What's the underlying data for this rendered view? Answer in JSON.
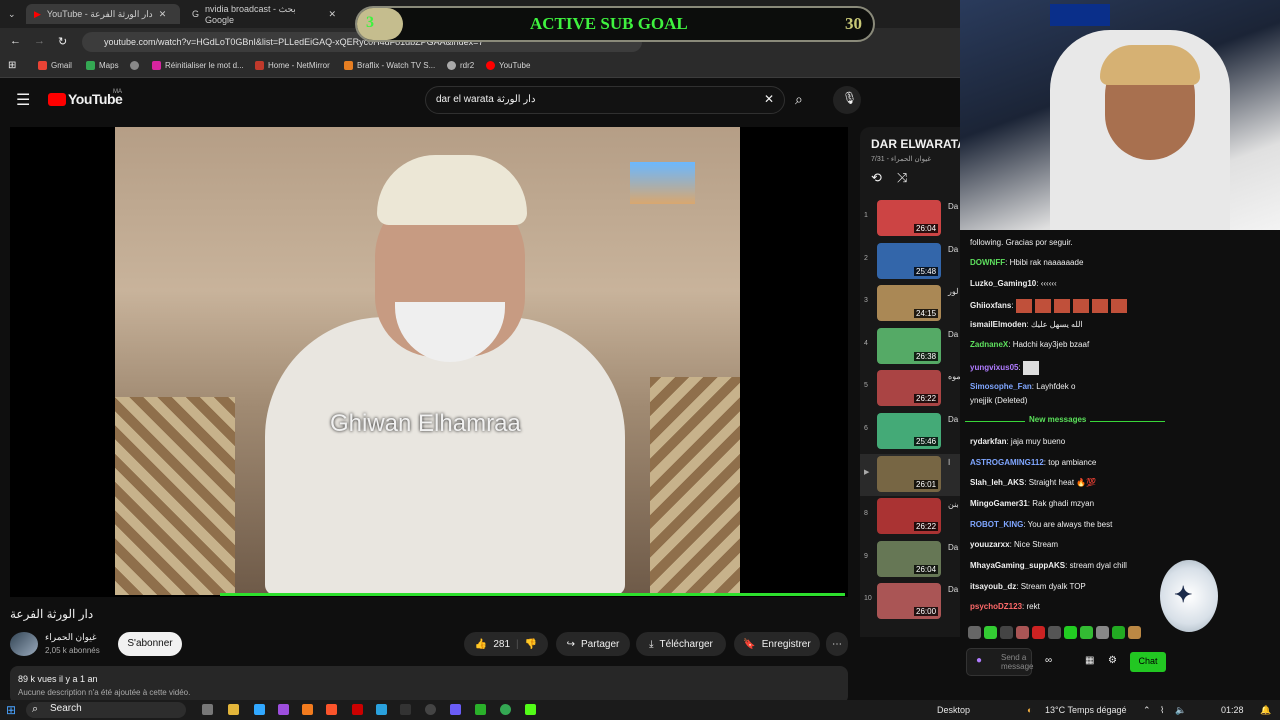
{
  "browser": {
    "tabs": [
      {
        "label": "YouTube - دار الورثة الفرعة"
      },
      {
        "label": "nvidia broadcast - بحث Google"
      }
    ],
    "url": "youtube.com/watch?v=HGdLoT0GBnI&list=PLLedEiGAQ-xQERyc0H4dFo1dbZPGAA&index=7",
    "bookmarks": [
      "Gmail",
      "Maps",
      "Réinitialiser le mot d...",
      "Home - NetMirror",
      "Braflix - Watch TV S...",
      "rdr2",
      "YouTube"
    ]
  },
  "youtube": {
    "logo": "YouTube",
    "logo_sup": "MA",
    "search_value": "dar el warata دار الورثة",
    "video_title": "دار الورثة الفرعة",
    "watermark": "Ghiwan Elhamraa",
    "channel_name": "غيوان الحمراء",
    "channel_subs": "2,05 k abonnés",
    "subscribe": "S'abonner",
    "likes": "281",
    "share": "Partager",
    "download": "Télécharger",
    "save": "Enregistrer",
    "views": "89 k vues  il y a 1 an",
    "description": "Aucune description n'a été ajoutée à cette vidéo."
  },
  "playlist": {
    "title": "DAR ELWARATA",
    "subtitle": "غيوان الحمراء - 7/31",
    "items": [
      {
        "num": "1",
        "dur": "26:04",
        "t": "Da"
      },
      {
        "num": "2",
        "dur": "25:48",
        "t": "Da"
      },
      {
        "num": "3",
        "dur": "24:15",
        "t": "لور"
      },
      {
        "num": "4",
        "dur": "26:38",
        "t": "Da"
      },
      {
        "num": "5",
        "dur": "26:22",
        "t": "موه"
      },
      {
        "num": "6",
        "dur": "25:46",
        "t": "Da"
      },
      {
        "num": "▶",
        "dur": "26:01",
        "t": "ا"
      },
      {
        "num": "8",
        "dur": "26:22",
        "t": "بنن"
      },
      {
        "num": "9",
        "dur": "26:04",
        "t": "Da"
      },
      {
        "num": "10",
        "dur": "26:00",
        "t": "Da"
      }
    ]
  },
  "overlay": {
    "goal_title": "ACTIVE SUB GOAL",
    "goal_current": "3",
    "goal_target": "30"
  },
  "chat": {
    "messages": [
      {
        "user": "",
        "text": "following. Gracias por seguir.",
        "color": "#efefef"
      },
      {
        "user": "DOWNFF",
        "text": "Hbibi rak naaaaaade",
        "color": "#5ee05e"
      },
      {
        "user": "Luzko_Gaming10",
        "text": "‹‹‹‹‹‹",
        "color": "#efefef"
      },
      {
        "user": "Ghiioxfans",
        "text": "",
        "color": "#efefef"
      },
      {
        "user": "ismailElmoden",
        "text": "الله يسهل عليك",
        "color": "#efefef"
      },
      {
        "user": "ZadnaneX",
        "text": "Hadchi kay3jeb bzaaf",
        "color": "#5ee05e"
      },
      {
        "user": "yungvixus05",
        "text": "",
        "color": "#b07cff"
      },
      {
        "user": "Simosophe_Fan",
        "text": "Layhfdek o",
        "color": "#7fa6ff"
      },
      {
        "user": "",
        "text": "ynejjik (Deleted)",
        "color": "#efefef"
      },
      {
        "user": "rydarkfan",
        "text": "jaja muy bueno",
        "color": "#efefef"
      },
      {
        "user": "ASTROGAMING112",
        "text": "top ambiance",
        "color": "#7fa6ff"
      },
      {
        "user": "Slah_leh_AKS",
        "text": "Straight heat 🔥💯",
        "color": "#efefef"
      },
      {
        "user": "MingoGamer31",
        "text": "Rak ghadi mzyan",
        "color": "#efefef"
      },
      {
        "user": "ROBOT_KING",
        "text": "You are always the best",
        "color": "#7fa6ff"
      },
      {
        "user": "youuzarxx",
        "text": "Nice Stream",
        "color": "#efefef"
      },
      {
        "user": "MhayaGaming_suppAKS",
        "text": "stream dyal chill",
        "color": "#efefef"
      },
      {
        "user": "itsayoub_dz",
        "text": "Stream dyalk TOP",
        "color": "#efefef"
      },
      {
        "user": "psychoDZ123",
        "text": "rekt",
        "color": "#ff6a6a"
      }
    ],
    "new_messages": "New messages",
    "input_placeholder": "Send a message",
    "chat_button": "Chat"
  },
  "taskbar": {
    "search": "Search",
    "desktop": "Desktop",
    "weather": "13°C  Temps dégagé",
    "time": "01:28"
  }
}
